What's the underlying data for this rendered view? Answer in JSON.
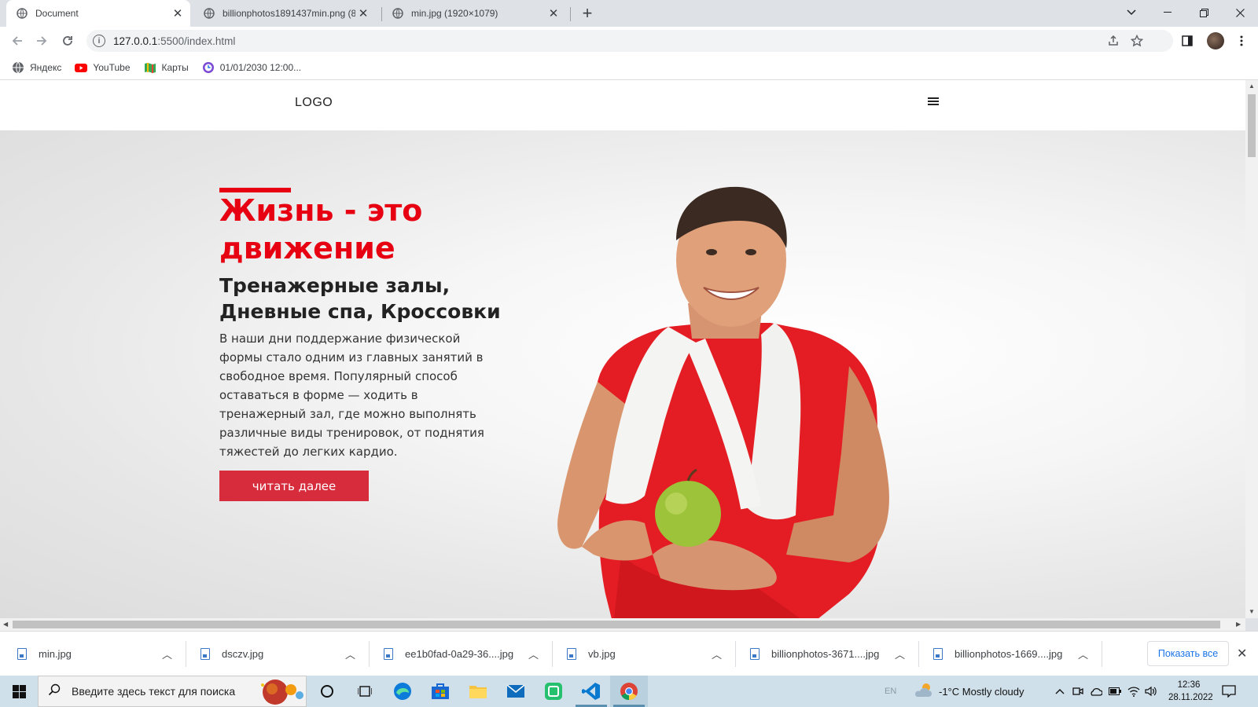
{
  "browser": {
    "tabs": [
      {
        "title": "Document",
        "active": true
      },
      {
        "title": "billionphotos1891437min.png (8",
        "active": false
      },
      {
        "title": "min.jpg (1920×1079)",
        "active": false
      }
    ],
    "new_tab": "+",
    "address": {
      "host": "127.0.0.1",
      "rest": ":5500/index.html"
    },
    "bookmarks": [
      {
        "label": "Яндекс",
        "icon": "globe-icon"
      },
      {
        "label": "YouTube",
        "icon": "youtube-icon"
      },
      {
        "label": "Карты",
        "icon": "maps-icon"
      },
      {
        "label": "01/01/2030 12:00...",
        "icon": "clock-icon"
      }
    ]
  },
  "site": {
    "logo": "LOGO",
    "hero": {
      "title": "Жизнь - это движение",
      "subtitle": "Тренажерные залы, Дневные спа, Кроссовки",
      "text": "В наши дни поддержание физической формы стало одним из главных занятий в свободное время. Популярный способ оставаться в форме — ходить в тренажерный зал, где можно выполнять различные виды тренировок, от поднятия тяжестей до легких кардио.",
      "button": "читать далее"
    },
    "colors": {
      "accent": "#e60012",
      "button": "#d62c3c"
    }
  },
  "downloads": {
    "items": [
      "min.jpg",
      "dsczv.jpg",
      "ee1b0fad-0a29-36....jpg",
      "vb.jpg",
      "billionphotos-3671....jpg",
      "billionphotos-1669....jpg"
    ],
    "show_all": "Показать все"
  },
  "taskbar": {
    "search_placeholder": "Введите здесь текст для поиска",
    "lang": "EN",
    "weather": "-1°C  Mostly cloudy",
    "time": "12:36",
    "date": "28.11.2022"
  }
}
